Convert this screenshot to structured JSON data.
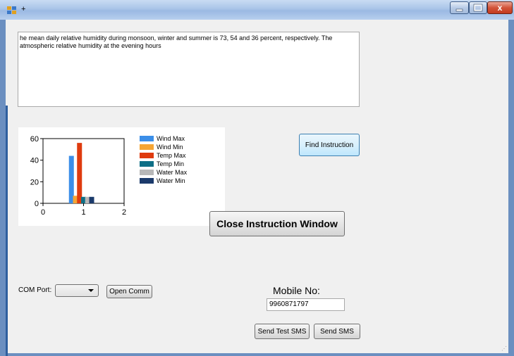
{
  "window": {
    "title": "+",
    "controls": {
      "minimize_icon": "minimize-icon",
      "maximize_icon": "maximize-icon",
      "close_icon": "close-icon",
      "close_glyph": "x"
    }
  },
  "instruction_text": "he mean daily relative humidity during monsoon, winter and summer is 73, 54 and 36 percent, respectively. The atmospheric relative humidity at the evening hours",
  "chart_data": {
    "type": "bar",
    "x_ticks": [
      "0",
      "1",
      "2"
    ],
    "y_ticks": [
      "60",
      "40",
      "20",
      "0"
    ],
    "xlim": [
      0,
      2
    ],
    "ylim": [
      0,
      60
    ],
    "grid": false,
    "legend_position": "right",
    "series": [
      {
        "name": "Wind Max",
        "x": 0.7,
        "value": 44,
        "color": "#3b8ee8"
      },
      {
        "name": "Wind Min",
        "x": 0.8,
        "value": 7,
        "color": "#f5a534"
      },
      {
        "name": "Temp Max",
        "x": 0.9,
        "value": 56,
        "color": "#df3b0e"
      },
      {
        "name": "Temp Min",
        "x": 1.0,
        "value": 6,
        "color": "#0e6f86"
      },
      {
        "name": "Water Max",
        "x": 1.1,
        "value": 6,
        "color": "#b8b8b8"
      },
      {
        "name": "Water Min",
        "x": 1.2,
        "value": 6,
        "color": "#1b3a6b"
      }
    ]
  },
  "buttons": {
    "find_instruction": "Find Instruction",
    "close_instruction": "Close Instruction Window",
    "open_comm": "Open Comm",
    "send_test_sms": "Send Test SMS",
    "send_sms": "Send SMS"
  },
  "com_port": {
    "label": "COM Port:",
    "selected": ""
  },
  "mobile": {
    "label": "Mobile No:",
    "value": "9960871797"
  }
}
